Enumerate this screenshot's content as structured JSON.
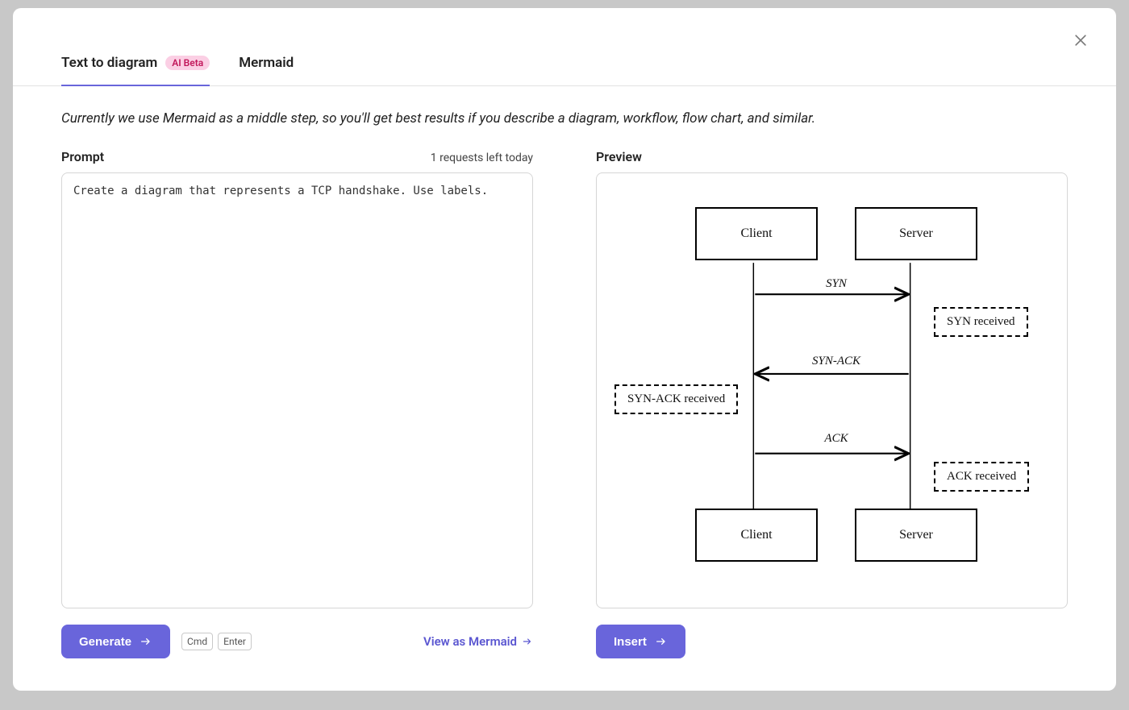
{
  "tabs": {
    "text_to_diagram": "Text to diagram",
    "ai_badge": "AI Beta",
    "mermaid": "Mermaid"
  },
  "hint": "Currently we use Mermaid as a middle step, so you'll get best results if you describe a diagram, workflow, flow chart, and similar.",
  "prompt": {
    "label": "Prompt",
    "requests_left": "1 requests left today",
    "value": "Create a diagram that represents a TCP handshake. Use labels."
  },
  "preview": {
    "label": "Preview"
  },
  "diagram": {
    "top_left": "Client",
    "top_right": "Server",
    "bottom_left": "Client",
    "bottom_right": "Server",
    "msg1": "SYN",
    "note1": "SYN received",
    "msg2": "SYN-ACK",
    "note2": "SYN-ACK received",
    "msg3": "ACK",
    "note3": "ACK received"
  },
  "actions": {
    "generate": "Generate",
    "kbd1": "Cmd",
    "kbd2": "Enter",
    "view_as_mermaid": "View as Mermaid",
    "insert": "Insert"
  }
}
